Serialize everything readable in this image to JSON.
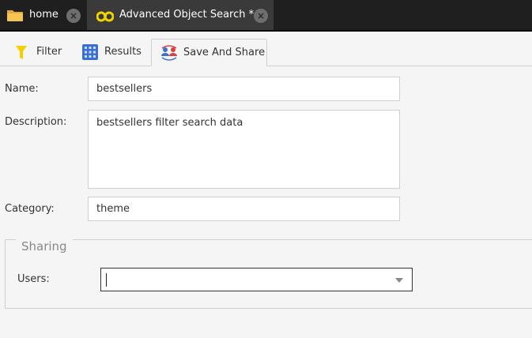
{
  "top_tabs": [
    {
      "label": "home",
      "icon": "folder-icon"
    },
    {
      "label": "Advanced Object Search *",
      "icon": "binoculars-icon"
    }
  ],
  "sub_tabs": [
    {
      "label": "Filter",
      "icon": "funnel-icon"
    },
    {
      "label": "Results",
      "icon": "grid-icon"
    },
    {
      "label": "Save And Share",
      "icon": "users-share-icon"
    }
  ],
  "form": {
    "name_label": "Name:",
    "name_value": "bestsellers",
    "description_label": "Description:",
    "description_value": "bestsellers filter search data",
    "category_label": "Category:",
    "category_value": "theme"
  },
  "sharing": {
    "legend": "Sharing",
    "users_label": "Users:",
    "users_value": ""
  },
  "colors": {
    "tab_bar": "#1f1f1f",
    "active_tab": "#3a3a3a",
    "funnel": "#f5d000",
    "grid": "#3b6fd1",
    "binoculars": "#f0d400"
  }
}
